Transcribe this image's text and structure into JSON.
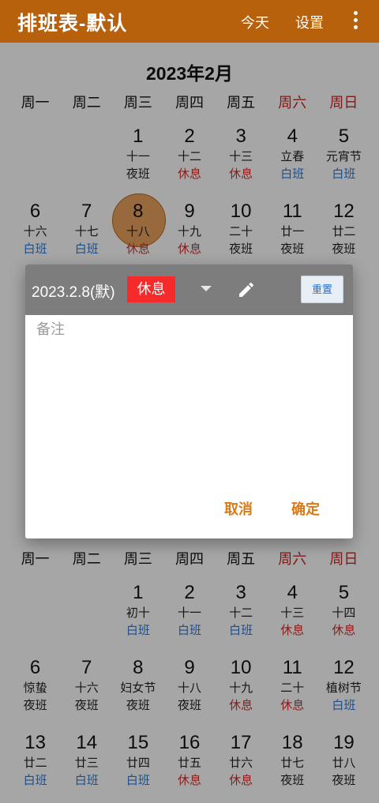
{
  "appbar": {
    "title": "排班表-默认",
    "today": "今天",
    "settings": "设置",
    "more_icon": "more-vert-icon"
  },
  "feb": {
    "title": "2023年2月",
    "weekdays": [
      "周一",
      "周二",
      "周三",
      "周四",
      "周五",
      "周六",
      "周日"
    ],
    "row1": [
      {
        "day": "1",
        "lunar": "十一",
        "shift": "夜班"
      },
      {
        "day": "2",
        "lunar": "十二",
        "shift": "休息"
      },
      {
        "day": "3",
        "lunar": "十三",
        "shift": "休息"
      },
      {
        "day": "4",
        "lunar": "立春",
        "shift": "白班"
      },
      {
        "day": "5",
        "lunar": "元宵节",
        "shift": "白班"
      }
    ],
    "row2": [
      {
        "day": "6",
        "lunar": "十六",
        "shift": "白班"
      },
      {
        "day": "7",
        "lunar": "十七",
        "shift": "白班"
      },
      {
        "day": "8",
        "lunar": "十八",
        "shift": "休息"
      },
      {
        "day": "9",
        "lunar": "十九",
        "shift": "休息"
      },
      {
        "day": "10",
        "lunar": "二十",
        "shift": "夜班"
      },
      {
        "day": "11",
        "lunar": "廿一",
        "shift": "夜班"
      },
      {
        "day": "12",
        "lunar": "廿二",
        "shift": "夜班"
      }
    ]
  },
  "mar": {
    "weekdays": [
      "周一",
      "周二",
      "周三",
      "周四",
      "周五",
      "周六",
      "周日"
    ],
    "row1": [
      {
        "day": "1",
        "lunar": "初十",
        "shift": "白班"
      },
      {
        "day": "2",
        "lunar": "十一",
        "shift": "白班"
      },
      {
        "day": "3",
        "lunar": "十二",
        "shift": "白班"
      },
      {
        "day": "4",
        "lunar": "十三",
        "shift": "休息"
      },
      {
        "day": "5",
        "lunar": "十四",
        "shift": "休息"
      }
    ],
    "row2": [
      {
        "day": "6",
        "lunar": "惊蛰",
        "shift": "夜班"
      },
      {
        "day": "7",
        "lunar": "十六",
        "shift": "夜班"
      },
      {
        "day": "8",
        "lunar": "妇女节",
        "shift": "夜班"
      },
      {
        "day": "9",
        "lunar": "十八",
        "shift": "夜班"
      },
      {
        "day": "10",
        "lunar": "十九",
        "shift": "休息"
      },
      {
        "day": "11",
        "lunar": "二十",
        "shift": "休息"
      },
      {
        "day": "12",
        "lunar": "植树节",
        "shift": "白班"
      }
    ],
    "row3": [
      {
        "day": "13",
        "lunar": "廿二",
        "shift": "白班"
      },
      {
        "day": "14",
        "lunar": "廿三",
        "shift": "白班"
      },
      {
        "day": "15",
        "lunar": "廿四",
        "shift": "白班"
      },
      {
        "day": "16",
        "lunar": "廿五",
        "shift": "休息"
      },
      {
        "day": "17",
        "lunar": "廿六",
        "shift": "休息"
      },
      {
        "day": "18",
        "lunar": "廿七",
        "shift": "夜班"
      },
      {
        "day": "19",
        "lunar": "廿八",
        "shift": "夜班"
      }
    ]
  },
  "dialog": {
    "date": "2023.2.8(默)",
    "shift": "休息",
    "shift_color": "#f52a2a",
    "reset": "重置",
    "note_placeholder": "备注",
    "cancel": "取消",
    "ok": "确定"
  },
  "colors": {
    "accent": "#b8610c",
    "day_shift": "#2f7ad9",
    "rest": "#d32f2f",
    "weekend": "#c62828"
  }
}
